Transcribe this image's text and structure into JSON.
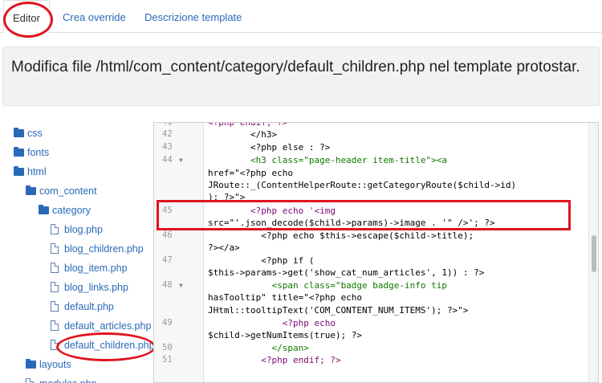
{
  "tabs": [
    {
      "label": "Editor",
      "active": true
    },
    {
      "label": "Crea override",
      "active": false
    },
    {
      "label": "Descrizione template",
      "active": false
    }
  ],
  "title": "Modifica file /html/com_content/category/default_children.php nel template protostar.",
  "tree": [
    {
      "type": "folder",
      "label": "css"
    },
    {
      "type": "folder",
      "label": "fonts"
    },
    {
      "type": "folder",
      "label": "html"
    },
    {
      "type": "folder",
      "label": "com_content"
    },
    {
      "type": "folder",
      "label": "category"
    },
    {
      "type": "file",
      "label": "blog.php"
    },
    {
      "type": "file",
      "label": "blog_children.php"
    },
    {
      "type": "file",
      "label": "blog_item.php"
    },
    {
      "type": "file",
      "label": "blog_links.php"
    },
    {
      "type": "file",
      "label": "default.php"
    },
    {
      "type": "file",
      "label": "default_articles.php"
    },
    {
      "type": "file",
      "label": "default_children.php"
    },
    {
      "type": "folder",
      "label": "layouts"
    },
    {
      "type": "file",
      "label": "modules.php"
    }
  ],
  "editor": {
    "line_numbers": [
      "42",
      "43",
      "44",
      "45",
      "46",
      "47",
      "48",
      "49",
      "50",
      "51"
    ],
    "fold_markers": {
      "44": "▼",
      "48": "▼"
    },
    "lines": [
      {
        "text": "<?php endif; ?>"
      },
      {
        "text": "        </h3>"
      },
      {
        "text": "        <?php else : ?>"
      },
      {
        "text": "        <h3 class=\"page-header item-title\"><a"
      },
      {
        "text": "href=\"<?php echo"
      },
      {
        "text": "JRoute::_(ContentHelperRoute::getCategoryRoute($child->id)"
      },
      {
        "text": "); ?>\">"
      },
      {
        "text": "        <?php echo '<img"
      },
      {
        "text": "src=\"'.json_decode($child->params)->image . '\" />'; ?>"
      },
      {
        "text": "          <?php echo $this->escape($child->title);"
      },
      {
        "text": "?></a>"
      },
      {
        "text": "          <?php if ("
      },
      {
        "text": "$this->params->get('show_cat_num_articles', 1)) : ?>"
      },
      {
        "text": "            <span class=\"badge badge-info tip"
      },
      {
        "text": "hasTooltip\" title=\"<?php echo"
      },
      {
        "text": "JHtml::tooltipText('COM_CONTENT_NUM_ITEMS'); ?>\">"
      },
      {
        "text": "              <?php echo"
      },
      {
        "text": "$child->getNumItems(true); ?>"
      },
      {
        "text": "            </span>"
      },
      {
        "text": "          <?php endif; ?>"
      }
    ],
    "top_partial_line_number": "41"
  },
  "colors": {
    "link": "#2a69b8",
    "annotation": "#e0141e",
    "title_bg": "#f2f2f2"
  }
}
